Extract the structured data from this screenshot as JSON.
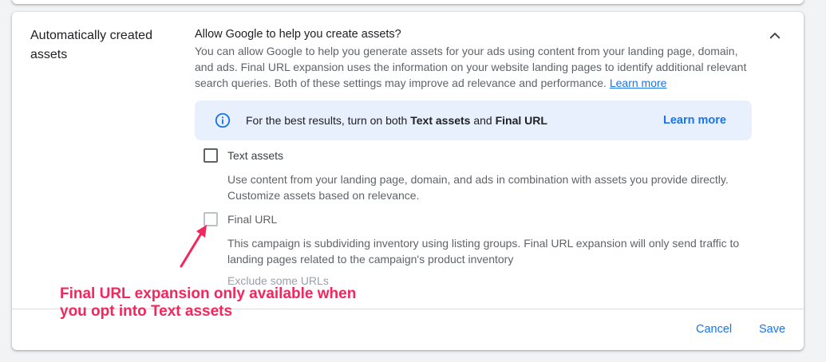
{
  "section": {
    "title": "Automatically created assets"
  },
  "intro": {
    "heading": "Allow Google to help you create assets?",
    "description": "You can allow Google to help you generate assets for your ads using content from your landing page, domain, and ads. Final URL expansion uses the information on your website landing pages to identify additional relevant search queries. Both of these settings may improve ad relevance and performance.",
    "learn_more": "Learn more"
  },
  "banner": {
    "icon": "info-icon",
    "text_prefix": "For the best results, turn on both ",
    "text_bold_1": "Text assets",
    "text_middle": " and ",
    "text_bold_2": "Final URL",
    "link": "Learn more"
  },
  "options": {
    "text_assets": {
      "label": "Text assets",
      "checked": false,
      "description": "Use content from your landing page, domain, and ads in combination with assets you provide directly. Customize assets based on relevance."
    },
    "final_url": {
      "label": "Final URL",
      "checked": false,
      "disabled": true,
      "description": "This campaign is subdividing inventory using listing groups. Final URL expansion will only send traffic to landing pages related to the campaign's product inventory"
    },
    "exclude_link": "Exclude some URLs"
  },
  "footer": {
    "cancel": "Cancel",
    "save": "Save"
  },
  "annotation": {
    "text": "Final URL expansion only available when you opt into Text assets",
    "color": "#f2275d"
  },
  "colors": {
    "accent": "#1a73e8",
    "banner_bg": "#e8f0fe"
  }
}
